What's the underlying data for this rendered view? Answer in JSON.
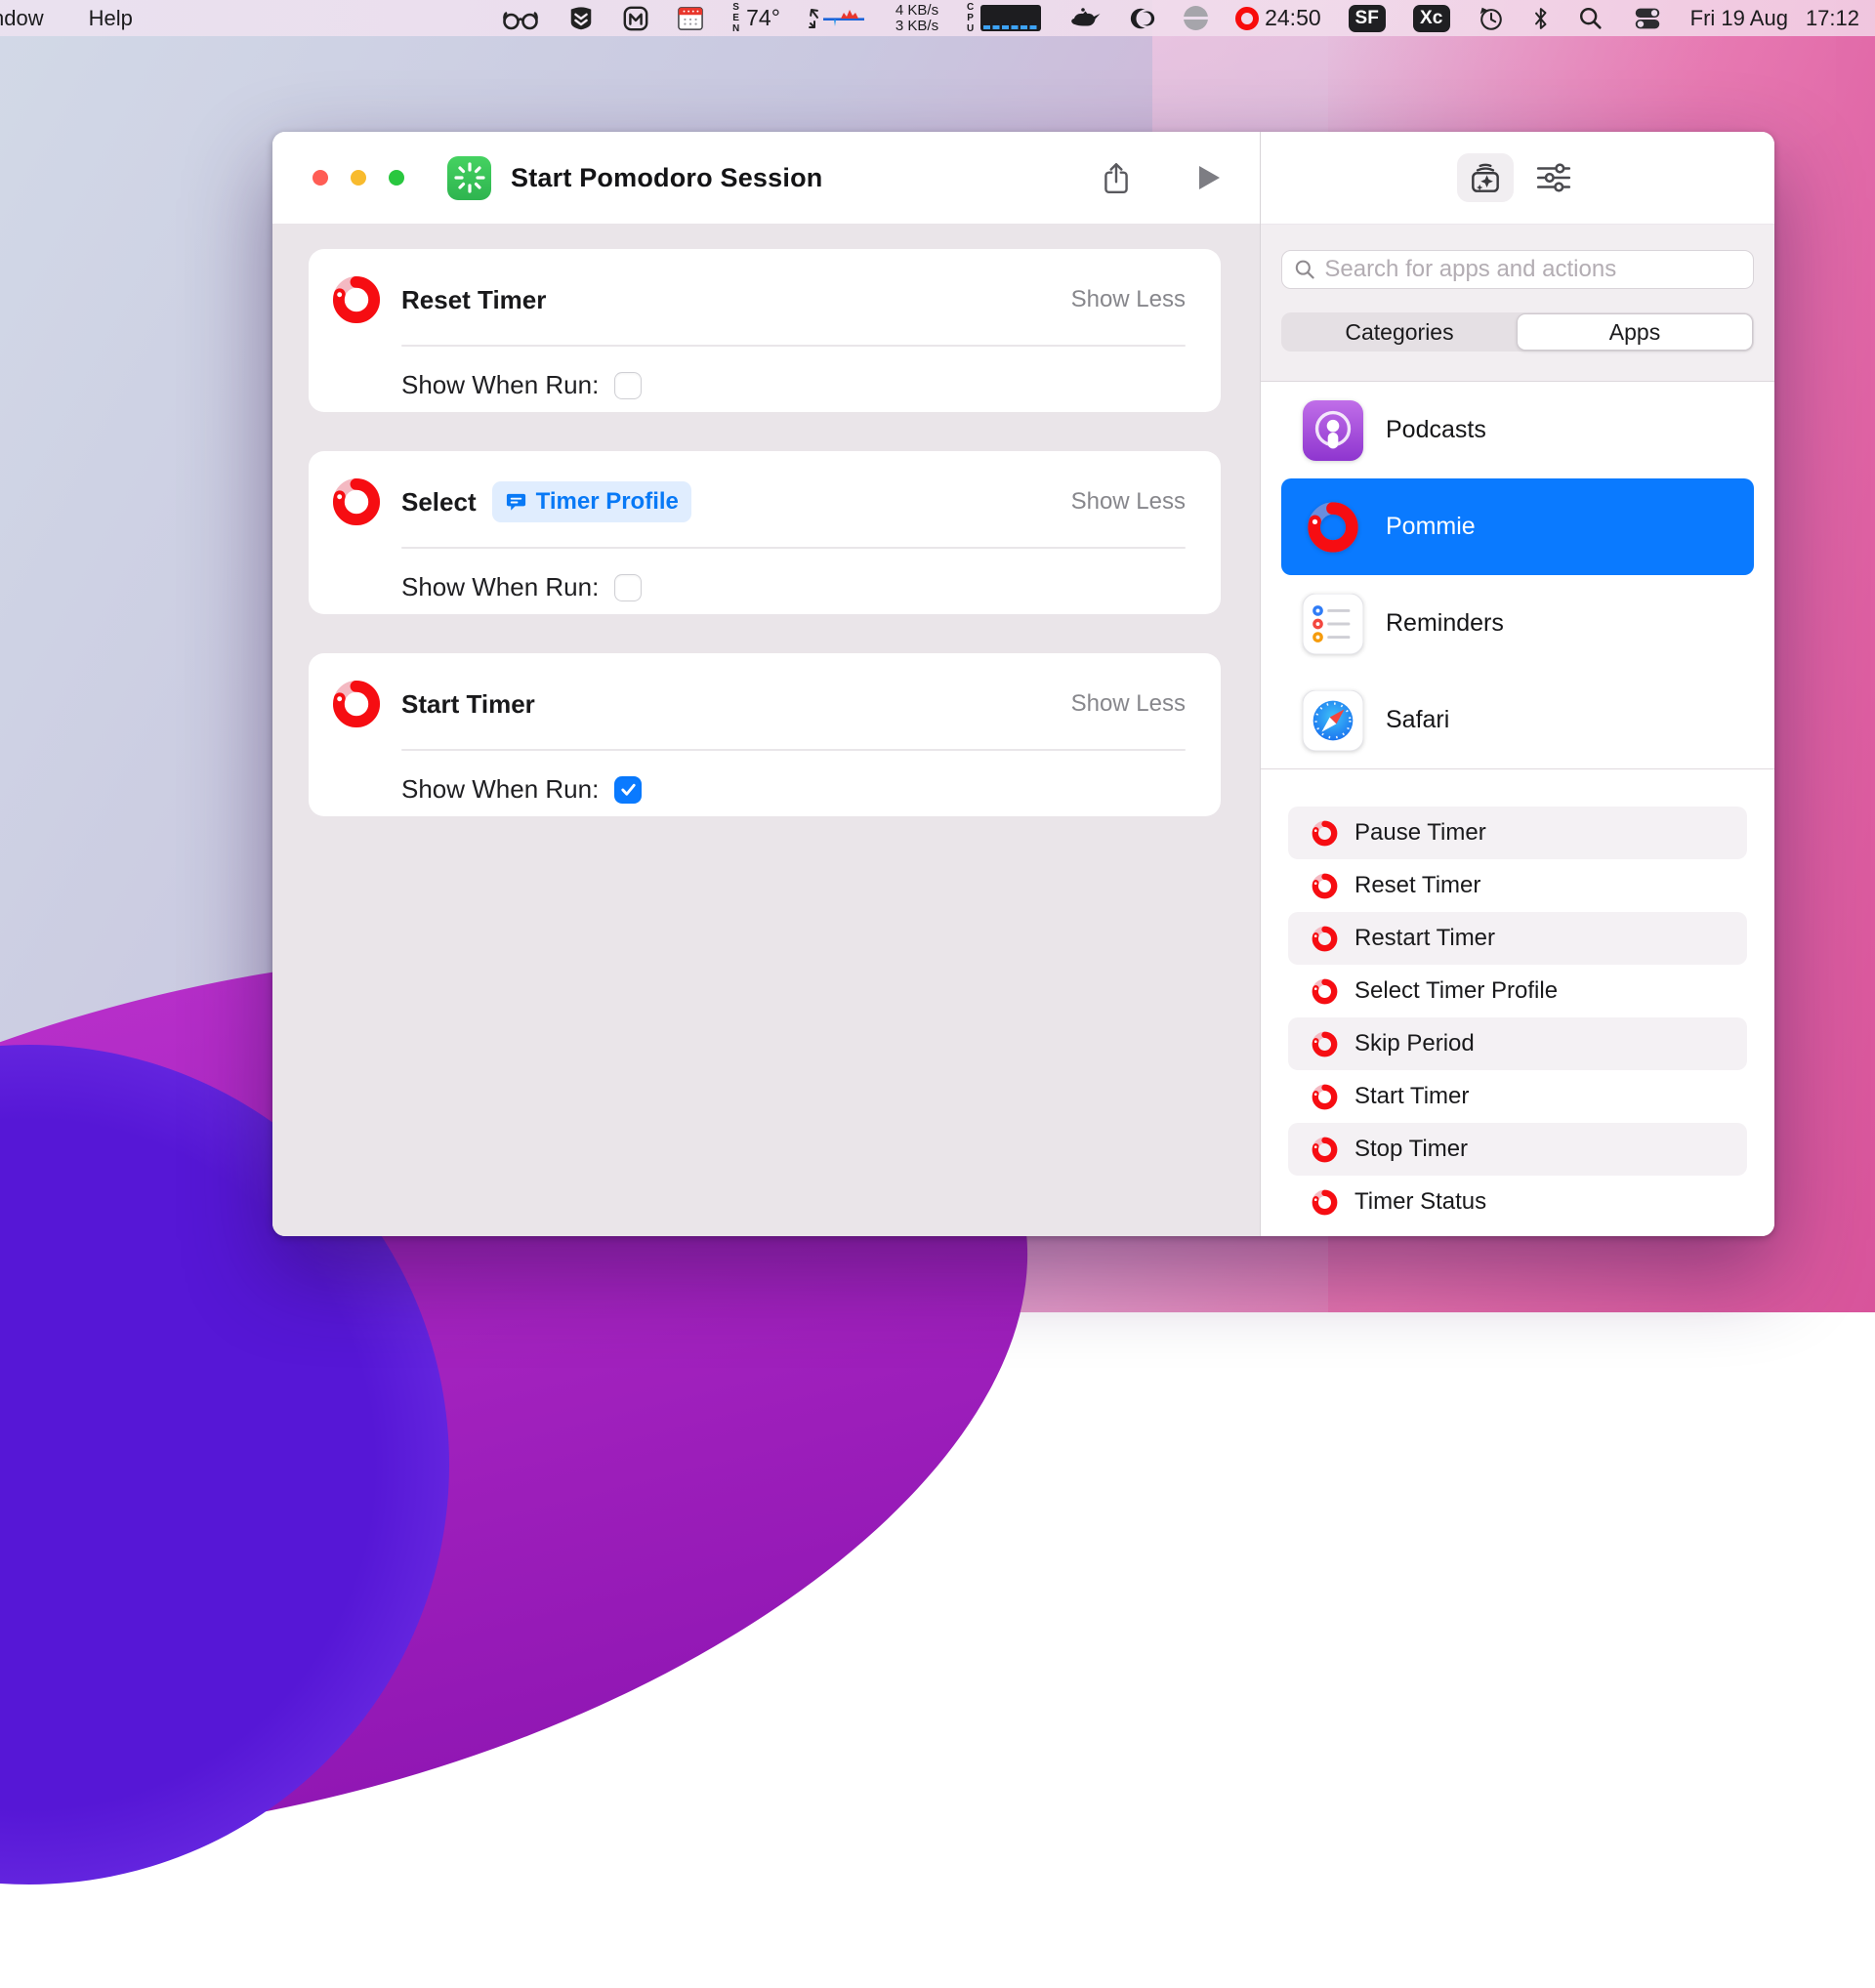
{
  "menu_bar": {
    "window_menu": "ndow",
    "help_menu": "Help",
    "sensor_label": "SEN",
    "temperature": "74°",
    "net_up": "4 KB/s",
    "net_down": "3 KB/s",
    "cpu_label": "CPU",
    "pomodoro_time": "24:50",
    "sf_badge": "SF",
    "xc_badge": "Xc",
    "date": "Fri 19 Aug",
    "time": "17:12"
  },
  "window": {
    "title": "Start Pomodoro Session",
    "cards": [
      {
        "title": "Reset Timer",
        "collapse": "Show Less",
        "param": "Show When Run:",
        "checked": false
      },
      {
        "title": "Select",
        "token": "Timer Profile",
        "collapse": "Show Less",
        "param": "Show When Run:",
        "checked": false
      },
      {
        "title": "Start Timer",
        "collapse": "Show Less",
        "param": "Show When Run:",
        "checked": true
      }
    ]
  },
  "sidebar": {
    "search_placeholder": "Search for apps and actions",
    "tabs": [
      {
        "label": "Categories",
        "selected": false
      },
      {
        "label": "Apps",
        "selected": true
      }
    ],
    "apps": [
      {
        "name": "Podcasts",
        "selected": false
      },
      {
        "name": "Pommie",
        "selected": true
      },
      {
        "name": "Reminders",
        "selected": false
      },
      {
        "name": "Safari",
        "selected": false
      }
    ],
    "actions": [
      "Pause Timer",
      "Reset Timer",
      "Restart Timer",
      "Select Timer Profile",
      "Skip Period",
      "Start Timer",
      "Stop Timer",
      "Timer Status"
    ]
  },
  "colors": {
    "accent_blue": "#0a7aff",
    "pommie_red": "#f60d12",
    "shortcut_green": "#35c759",
    "selection_token_bg": "#e0edfe"
  }
}
